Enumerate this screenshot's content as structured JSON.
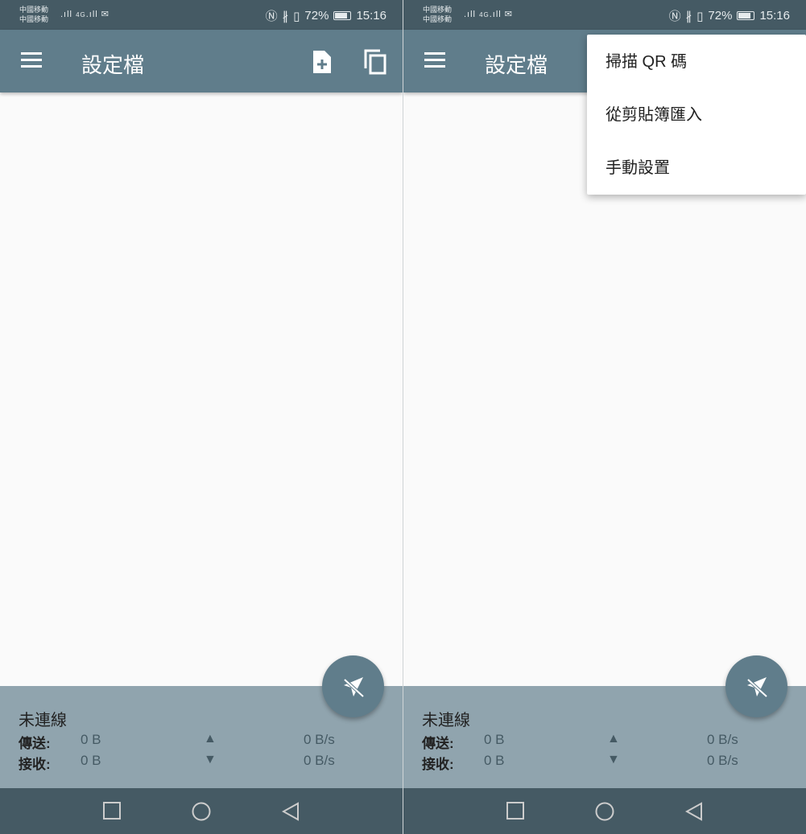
{
  "status_bar": {
    "carrier1": "中國移動",
    "carrier2": "中國移動",
    "signal": "4G",
    "battery": "72%",
    "time": "15:16"
  },
  "toolbar": {
    "title": "設定檔"
  },
  "icons": {
    "menu": "hamburger-icon",
    "add": "file-add-icon",
    "copy": "copy-icon",
    "fab": "plane-off-icon"
  },
  "stats": {
    "state": "未連線",
    "sent_label": "傳送:",
    "sent_value": "0 B",
    "sent_arrow": "▲",
    "sent_rate": "0 B/s",
    "recv_label": "接收:",
    "recv_value": "0 B",
    "recv_arrow": "▼",
    "recv_rate": "0 B/s"
  },
  "popup_menu": {
    "items": [
      "掃描 QR 碼",
      "從剪貼簿匯入",
      "手動設置"
    ]
  },
  "colors": {
    "status": "#455a64",
    "toolbar": "#607d8b",
    "panel": "#90a4ae"
  }
}
